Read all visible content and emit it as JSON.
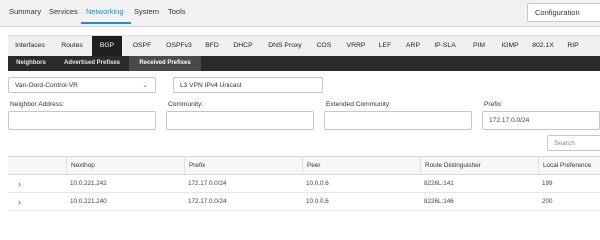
{
  "topnav": {
    "items": [
      "Summary",
      "Services",
      "Networking",
      "System",
      "Tools"
    ],
    "active": "Networking",
    "config_label": "Configuration"
  },
  "protocol_tabs": {
    "items": [
      "Interfaces",
      "Routes",
      "BGP",
      "OSPF",
      "OSPFv3",
      "BFD",
      "DHCP",
      "DNS Proxy",
      "COS",
      "VRRP",
      "LEF",
      "ARP",
      "IP-SLA",
      "PIM",
      "IGMP",
      "802.1X",
      "RIP"
    ],
    "active": "BGP"
  },
  "sub_tabs": {
    "items": [
      "Neighbors",
      "Advertised Prefixes",
      "Received Prefixes"
    ],
    "active": "Received Prefixes"
  },
  "selects": {
    "vr": "Van-Oord-Control-VR",
    "family": "L3 VPN IPv4 Unicast"
  },
  "filters": {
    "neighbor_address": {
      "label": "Neighbor Address:",
      "value": ""
    },
    "community": {
      "label": "Community:",
      "value": ""
    },
    "extended_community": {
      "label": "Extended Community:",
      "value": ""
    },
    "prefix": {
      "label": "Prefix:",
      "value": "172.17.0.0/24"
    }
  },
  "search": {
    "placeholder": "Search"
  },
  "table": {
    "columns": [
      "Nexthop",
      "Prefix",
      "Peer",
      "Route Distinguisher",
      "Local Preference"
    ],
    "rows": [
      [
        "10.0.221.242",
        "172.17.0.0/24",
        "10.0.0.6",
        "8226L:141",
        "199"
      ],
      [
        "10.0.221.240",
        "172.17.0.0/24",
        "10.0.0.6",
        "8226L:146",
        "200"
      ]
    ]
  }
}
